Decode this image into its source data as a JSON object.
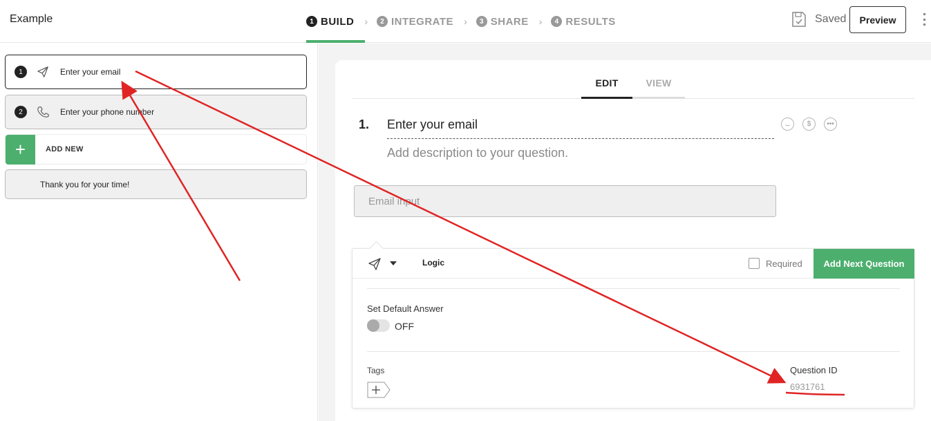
{
  "app": {
    "title": "Example"
  },
  "steps": [
    {
      "num": "1",
      "label": "BUILD",
      "active": true
    },
    {
      "num": "2",
      "label": "INTEGRATE",
      "active": false
    },
    {
      "num": "3",
      "label": "SHARE",
      "active": false
    },
    {
      "num": "4",
      "label": "RESULTS",
      "active": false
    }
  ],
  "header": {
    "saved_label": "Saved",
    "preview_label": "Preview"
  },
  "sidebar": {
    "questions": [
      {
        "num": "1",
        "icon": "paper-plane-icon",
        "label": "Enter your email"
      },
      {
        "num": "2",
        "icon": "phone-icon",
        "label": "Enter your phone number"
      }
    ],
    "add_new": {
      "icon": "plus",
      "label": "ADD NEW"
    },
    "thank_you": "Thank you for your time!"
  },
  "editor": {
    "tabs": {
      "edit": "EDIT",
      "view": "VIEW"
    },
    "question": {
      "index": "1.",
      "title": "Enter your email",
      "description_placeholder": "Add description to your question."
    },
    "input_placeholder": "Email input",
    "settings": {
      "logic_label": "Logic",
      "required_label": "Required",
      "add_next_label": "Add Next Question",
      "default_answer_label": "Set Default Answer",
      "default_answer_state": "OFF",
      "tags_label": "Tags",
      "question_id_label": "Question ID",
      "question_id_value": "6931761"
    }
  },
  "colors": {
    "accent": "#4caf6e",
    "annotation": "#e02424"
  }
}
